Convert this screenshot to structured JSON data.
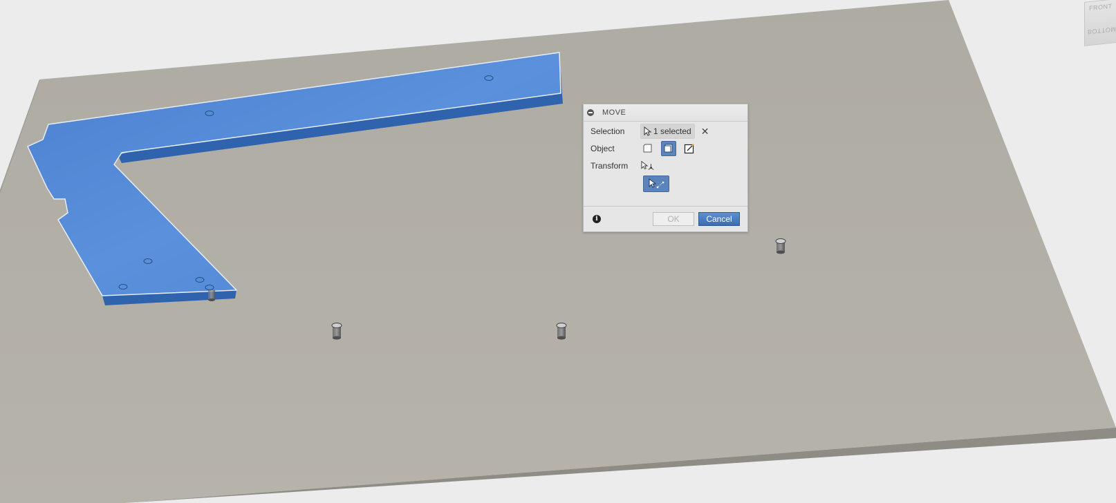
{
  "viewcube": {
    "front_label": "FRONT",
    "bottom_label": "BOTTOM"
  },
  "dialog": {
    "title": "MOVE",
    "selection_label": "Selection",
    "selection_value": "1 selected",
    "clear_glyph": "✕",
    "object_label": "Object",
    "transform_label": "Transform",
    "info_glyph": "i",
    "ok_label": "OK",
    "cancel_label": "Cancel",
    "object_modes": [
      {
        "icon": "face-icon",
        "active": false
      },
      {
        "icon": "body-icon",
        "active": true
      },
      {
        "icon": "sketch-icon",
        "active": false
      }
    ],
    "transform_modes": [
      {
        "icon": "free-move-icon",
        "active": false
      },
      {
        "icon": "point-to-point-icon",
        "active": true
      }
    ]
  },
  "colors": {
    "background": "#ececec",
    "base_plate": "#b1aea6",
    "base_plate_edge": "#8f8c85",
    "selected_body": "#4f86d4",
    "selected_body_wall": "#2f63ad",
    "accent_button": "#5a84bb"
  }
}
